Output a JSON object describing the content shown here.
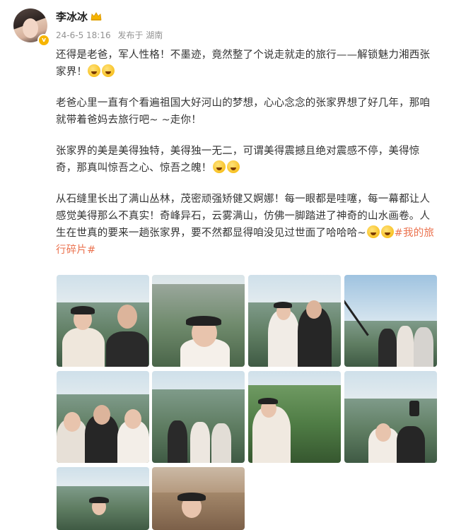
{
  "header": {
    "name": "李冰冰",
    "timestamp": "24-6-5 18:16",
    "source": "发布于 湖南",
    "verified_badge": "v"
  },
  "content": {
    "p1": "还得是老爸，军人性格！不墨迹，竟然整了个说走就走的旅行——解锁魅力湘西张家界！",
    "p2": "老爸心里一直有个看遍祖国大好河山的梦想，心心念念的张家界想了好几年，那咱就带着爸妈去旅行吧~ ~走你！",
    "p3": "张家界的美是美得独特，美得独一无二，可谓美得震撼且绝对震感不停，美得惊奇，那真叫惊吾之心、惊吾之魄！",
    "p4": "从石缝里长出了满山丛林，茂密顽强矫健又婀娜！每一眼都是哇噻，每一幕都让人感觉美得那么不真实！奇峰异石，云雾满山，仿佛一脚踏进了神奇的山水画卷。人生在世真的要来一趟张家界，要不然都显得咱没见过世面了哈哈哈~",
    "hashtag": "#我的旅行碎片#"
  },
  "icons": {
    "avatar": "avatar-photo",
    "verified": "verified-v-icon",
    "member": "crown-icon",
    "emoji": "laughing-emoji-icon"
  },
  "colors": {
    "accent": "#eb7350",
    "meta_text": "#939393",
    "badge": "#f7b500"
  },
  "photos": [
    {
      "label": "photo-1"
    },
    {
      "label": "photo-2"
    },
    {
      "label": "photo-3"
    },
    {
      "label": "photo-4"
    },
    {
      "label": "photo-5"
    },
    {
      "label": "photo-6"
    },
    {
      "label": "photo-7"
    },
    {
      "label": "photo-8"
    },
    {
      "label": "photo-9"
    },
    {
      "label": "photo-10"
    }
  ]
}
